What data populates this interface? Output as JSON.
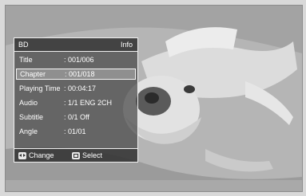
{
  "info_panel": {
    "source": "BD",
    "mode": "Info",
    "rows": [
      {
        "label": "Title",
        "value": ": 001/006"
      },
      {
        "label": "Chapter",
        "value": ": 001/018"
      },
      {
        "label": "Playing Time",
        "value": ": 00:04:17"
      },
      {
        "label": "Audio",
        "value": ": 1/1 ENG 2CH"
      },
      {
        "label": "Subtitle",
        "value": ": 0/1 Off"
      },
      {
        "label": "Angle",
        "value": ": 01/01"
      }
    ],
    "selected_row": "Chapter",
    "footer": {
      "change_label": "Change",
      "select_label": "Select"
    }
  },
  "colors": {
    "panel_bg": "#464646",
    "panel_border": "#f0f0f0",
    "highlight": "#969696",
    "screen_bg": "#bdbdbd"
  },
  "icons": {
    "change": "left-right-arrows-icon",
    "select": "enter-icon"
  }
}
